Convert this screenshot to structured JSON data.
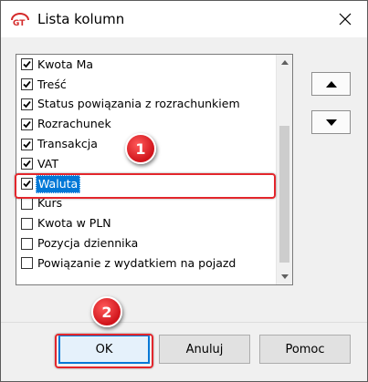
{
  "window": {
    "title": "Lista kolumn",
    "app_icon": "gt-logo-icon",
    "close_icon": "close-icon"
  },
  "columns_list": {
    "items": [
      {
        "label": "Kwota Ma",
        "checked": true
      },
      {
        "label": "Treść",
        "checked": true
      },
      {
        "label": "Status powiązania z rozrachunkiem",
        "checked": true
      },
      {
        "label": "Rozrachunek",
        "checked": true
      },
      {
        "label": "Transakcja",
        "checked": true
      },
      {
        "label": "VAT",
        "checked": true
      },
      {
        "label": "Waluta",
        "checked": true,
        "selected": true
      },
      {
        "label": "Kurs",
        "checked": false
      },
      {
        "label": "Kwota w PLN",
        "checked": false
      },
      {
        "label": "Pozycja dziennika",
        "checked": false
      },
      {
        "label": "Powiązanie z wydatkiem na pojazd",
        "checked": false
      }
    ]
  },
  "side_buttons": {
    "up_icon": "triangle-up-icon",
    "down_icon": "triangle-down-icon"
  },
  "buttons": {
    "ok": "OK",
    "cancel": "Anuluj",
    "help": "Pomoc"
  },
  "annotations": {
    "badge_1": "1",
    "badge_2": "2",
    "highlight_color": "#e3262c"
  },
  "colors": {
    "selection": "#0078d7",
    "dialog_bg": "#f0f0f0"
  }
}
